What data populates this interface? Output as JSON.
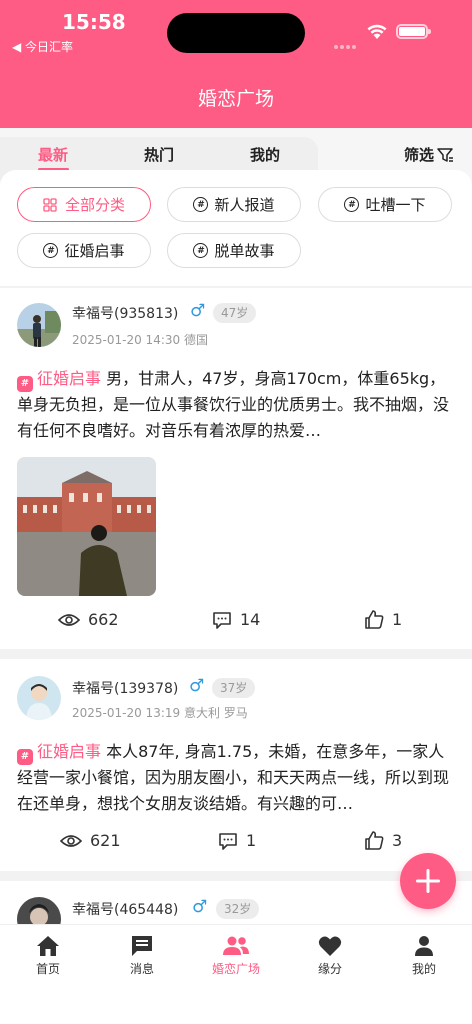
{
  "status": {
    "time": "15:58",
    "back_app": "◀ 今日汇率"
  },
  "nav": {
    "title": "婚恋广场"
  },
  "tabs": [
    {
      "label": "最新",
      "active": true
    },
    {
      "label": "热门",
      "active": false
    },
    {
      "label": "我的",
      "active": false
    }
  ],
  "filter": {
    "label": "筛选",
    "icon": "funnel-icon"
  },
  "categories": [
    {
      "label": "全部分类",
      "icon": "grid-icon",
      "active": true
    },
    {
      "label": "新人报道",
      "icon": "hashtag-icon"
    },
    {
      "label": "吐槽一下",
      "icon": "hashtag-icon"
    },
    {
      "label": "征婚启事",
      "icon": "hashtag-icon"
    },
    {
      "label": "脱单故事",
      "icon": "hashtag-icon"
    }
  ],
  "posts": [
    {
      "username": "幸福号(935813)",
      "gender": "♂",
      "age": "47岁",
      "meta": "2025-01-20 14:30 德国",
      "tag": "征婚启事",
      "text": "男，甘肃人，47岁，身高170cm，体重65kg，单身无负担，是一位从事餐饮行业的优质男士。我不抽烟，没有任何不良嗜好。对音乐有着浓厚的热爱…",
      "views": "662",
      "comments": "14",
      "likes": "1"
    },
    {
      "username": "幸福号(139378)",
      "gender": "♂",
      "age": "37岁",
      "meta": "2025-01-20 13:19 意大利 罗马",
      "tag": "征婚启事",
      "text": "本人87年, 身高1.75，未婚，在意多年，一家人经营一家小餐馆，因为朋友圈小，和天天两点一线，所以到现在还单身，想找个女朋友谈结婚。有兴趣的可…",
      "views": "621",
      "comments": "1",
      "likes": "3"
    },
    {
      "username": "幸福号(465448)",
      "gender": "♂",
      "age": "32岁"
    }
  ],
  "bottom_nav": [
    {
      "label": "首页",
      "icon": "home-icon"
    },
    {
      "label": "消息",
      "icon": "message-icon"
    },
    {
      "label": "婚恋广场",
      "icon": "people-icon",
      "active": true
    },
    {
      "label": "缘分",
      "icon": "heart-icon"
    },
    {
      "label": "我的",
      "icon": "person-icon"
    }
  ],
  "colors": {
    "accent": "#fe5c84",
    "gender_male": "#2d9ae0"
  }
}
